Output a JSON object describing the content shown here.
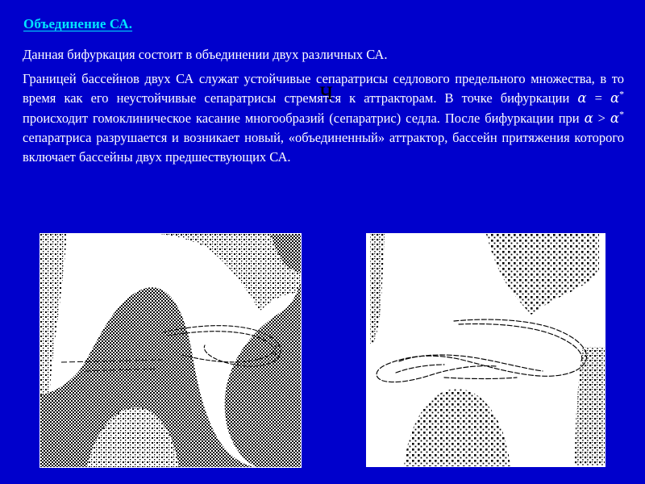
{
  "slide": {
    "background_color": "#0000cc",
    "title": "Объединение СА.",
    "title_color": "#00e5ff",
    "text_color": "#ffffff",
    "paragraphs": [
      {
        "id": "intro",
        "text": "Данная бифуркация состоит в объединении двух различных СА."
      },
      {
        "id": "main_part_1",
        "text": "Границей бассейнов двух СА служат устойчивые сепаратрисы седлового предельного множества, в то время как его неустойчивые сепаратрисы стремятся к аттракторам. В точке бифуркации "
      },
      {
        "id": "main_part_2",
        "text": " происходит гомоклиническое касание многообразий (сепаратрис) седла. После бифуркации при "
      },
      {
        "id": "main_part_3",
        "text": " сепаратриса разрушается и возникает новый, «объединенный» аттрактор, бассейн притяжения которого включает бассейны двух предшествующих СА."
      }
    ],
    "math": {
      "alpha": "α",
      "equals": "=",
      "greater_than": ">",
      "star": "*"
    },
    "stray_glyph": "ч"
  },
  "figures": [
    {
      "id": "figure-left",
      "name": "basin-before-bifurcation",
      "caption": "",
      "fill_color": "#000000",
      "background_color": "#ffffff"
    },
    {
      "id": "figure-right",
      "name": "basin-after-bifurcation",
      "caption": "",
      "fill_color": "#000000",
      "background_color": "#ffffff"
    }
  ]
}
